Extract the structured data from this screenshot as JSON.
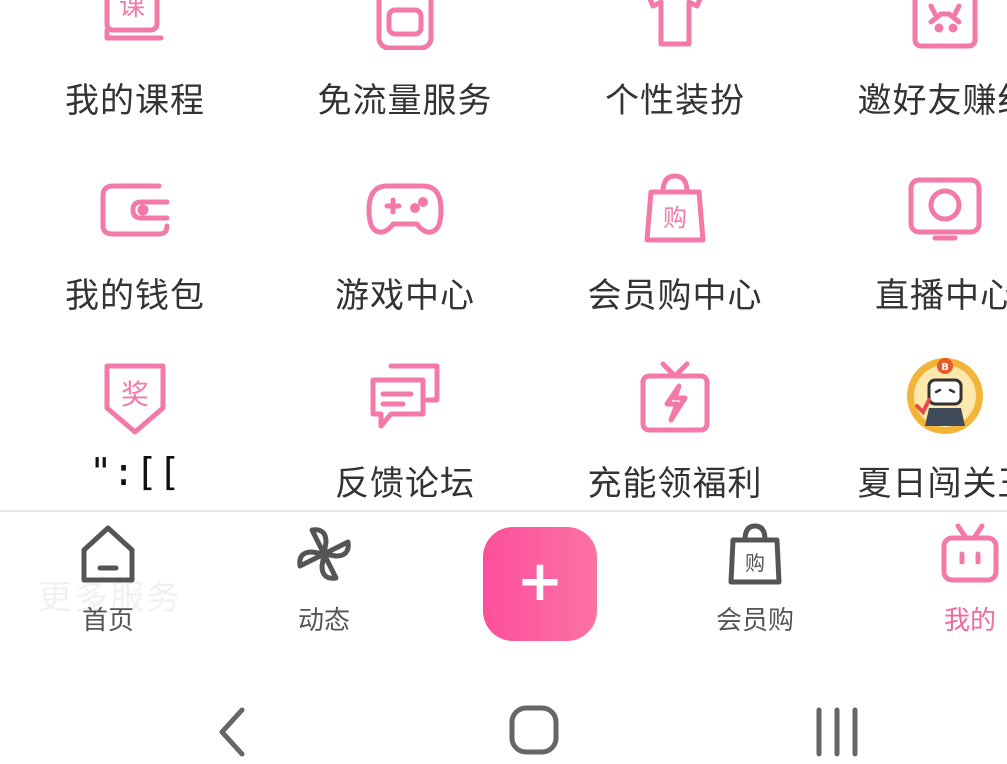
{
  "colors": {
    "accent": "#f06a9f",
    "icon_pink": "#f37aa8",
    "tab_gray": "#555555",
    "text": "#333333"
  },
  "services": [
    {
      "label": "我的课程",
      "icon": "course-book-icon"
    },
    {
      "label": "免流量服务",
      "icon": "phone-card-icon"
    },
    {
      "label": "个性装扮",
      "icon": "tshirt-icon"
    },
    {
      "label": "邀好友赚红",
      "icon": "invite-tv-icon"
    },
    {
      "label": "我的钱包",
      "icon": "wallet-icon"
    },
    {
      "label": "游戏中心",
      "icon": "gamepad-icon"
    },
    {
      "label": "会员购中心",
      "icon": "shopping-bag-icon"
    },
    {
      "label": "直播中心",
      "icon": "live-tv-icon"
    },
    {
      "label": "\":[[",
      "icon": "award-badge-icon"
    },
    {
      "label": "反馈论坛",
      "icon": "chat-bubbles-icon"
    },
    {
      "label": "充能领福利",
      "icon": "gift-lightning-icon"
    },
    {
      "label": "夏日闯关王",
      "icon": "summer-challenge-badge-icon"
    }
  ],
  "ghost_heading": "更多服务",
  "tabbar": {
    "home": "首页",
    "dynamic": "动态",
    "publish": "+",
    "mall": "会员购",
    "mine": "我的"
  },
  "system_nav": {
    "back": "back-icon",
    "home": "home-button-icon",
    "recents": "recents-icon"
  }
}
